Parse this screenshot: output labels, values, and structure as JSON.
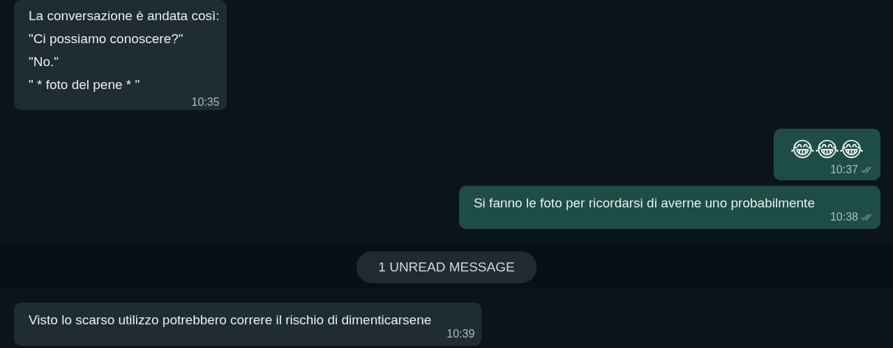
{
  "messages": [
    {
      "kind": "incoming",
      "lines": [
        "La conversazione è andata così:",
        "\"Ci possiamo conoscere?\"",
        "\"No.\"",
        "\" * foto del pene * \""
      ],
      "time": "10:35"
    },
    {
      "kind": "emoji",
      "lines": [
        "😂😂😂"
      ],
      "time": "10:37",
      "read": false
    },
    {
      "kind": "outgoing",
      "lines": [
        "Si fanno le foto per ricordarsi di averne uno probabilmente"
      ],
      "time": "10:38",
      "read": false
    },
    {
      "kind": "divider",
      "label": "1 UNREAD MESSAGE"
    },
    {
      "kind": "incoming",
      "lines": [
        "Visto lo scarso utilizzo potrebbero correre il rischio di dimenticarsene"
      ],
      "time": "10:39"
    }
  ]
}
